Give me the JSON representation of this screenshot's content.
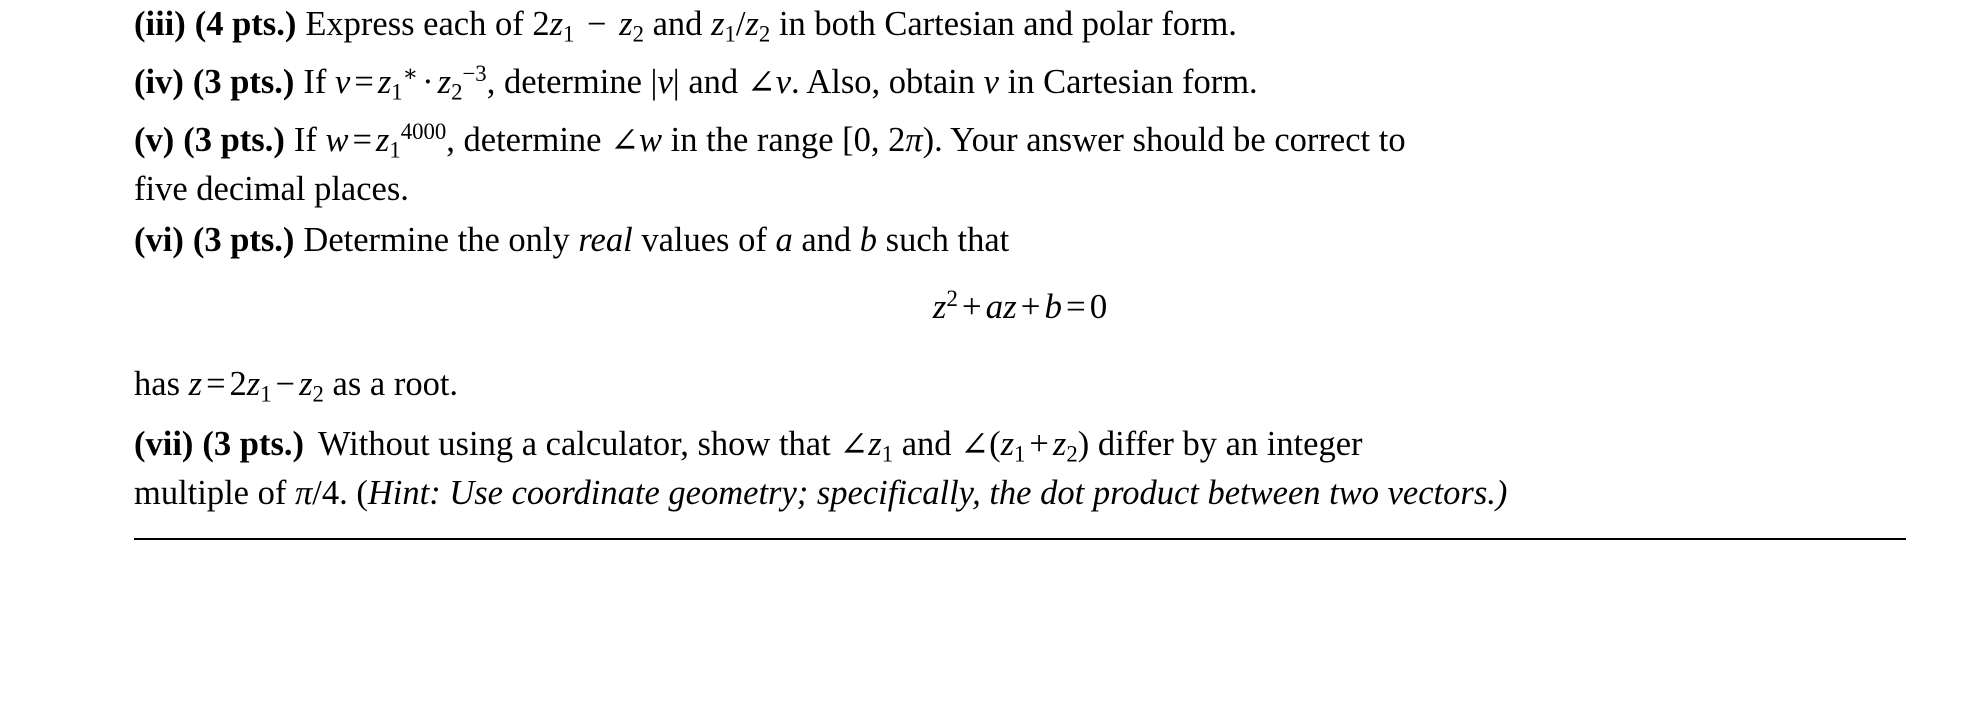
{
  "document": {
    "type": "math-problem-set",
    "font_color": "#000000",
    "background_color": "#ffffff"
  },
  "items": [
    {
      "id": "iii",
      "label": "(iii)",
      "points": "(4 pts.)",
      "text_parts": {
        "p1": "Express each of 2",
        "p2": "z",
        "sub1": "1",
        "p3": " − ",
        "p4": "z",
        "sub2": "2",
        "p5": " and ",
        "p6": "z",
        "sub3": "1",
        "p7": "/",
        "p8": "z",
        "sub4": "2",
        "p9": " in both Cartesian and polar form."
      },
      "plain": "(iii) (4 pts.) Express each of 2z₁ − z₂ and z₁/z₂ in both Cartesian and polar form."
    },
    {
      "id": "iv",
      "label": "(iv)",
      "points": "(3 pts.)",
      "plain": "(iv) (3 pts.) If v = z₁* · z₂⁻³, determine |v| and ∠v. Also, obtain v in Cartesian form.",
      "frag": {
        "if": "If ",
        "v": "v",
        "eq": "=",
        "z": "z",
        "one": "1",
        "star": "∗",
        "dot": "·",
        "z2": "z",
        "two": "2",
        "exp": "−3",
        "comma_determine": ", determine ",
        "absv_open": "|",
        "absv_close": "|",
        "and": " and ",
        "anglev": "v",
        "also": ". Also, obtain ",
        "vlast": "v",
        "tail": " in Cartesian form."
      }
    },
    {
      "id": "v",
      "label": "(v)",
      "points": "(3 pts.)",
      "plain": "(v) (3 pts.) If w = z₁^4000, determine ∠w in the range [0, 2π). Your answer should be correct to five decimal places.",
      "frag": {
        "if": "If ",
        "w": "w",
        "eq": "=",
        "z": "z",
        "one": "1",
        "power": "4000",
        "determine": ", determine ",
        "wang": "w",
        "range_text": " in the range [0, 2",
        "pi": "π",
        "range_close": "). Your answer should be correct to",
        "line2": "five decimal places."
      }
    },
    {
      "id": "vi",
      "label": "(vi)",
      "points": "(3 pts.)",
      "plain": "(vi) (3 pts.) Determine the only real values of a and b such that",
      "frag": {
        "t1": "Determine the only ",
        "real": "real",
        "t2": " values of ",
        "a": "a",
        "t3": " and ",
        "b": "b",
        "t4": " such that"
      }
    },
    {
      "id": "has-root",
      "plain": "has z = 2z₁ − z₂ as a root.",
      "frag": {
        "has": "has ",
        "z": "z",
        "eq": "=",
        "two": "2",
        "z1": "z",
        "sub1": "1",
        "minus": "−",
        "z2": "z",
        "sub2": "2",
        "tail": " as a root."
      }
    },
    {
      "id": "vii",
      "label": "(vii)",
      "points": "(3 pts.)",
      "plain": "(vii) (3 pts.) Without using a calculator, show that ∠z₁ and ∠(z₁ + z₂) differ by an integer multiple of π/4. (Hint: Use coordinate geometry; specifically, the dot product between two vectors.)",
      "frag": {
        "t1": "Without using a calculator, show that ",
        "z": "z",
        "sub1": "1",
        "t2": " and ",
        "open": "(",
        "z1b": "z",
        "sub1b": "1",
        "plus": "+",
        "z2b": "z",
        "sub2b": "2",
        "close": ")",
        "t3": " differ by an integer",
        "line2a": "multiple of ",
        "pi": "π",
        "slash4": "/4. (",
        "hint_label": "Hint:",
        "hint_text": " Use coordinate geometry; specifically, the dot product between two vectors.",
        "close_paren": ")"
      }
    }
  ],
  "equation": {
    "id": "quadratic",
    "plain": "z² + az + b = 0",
    "frag": {
      "z": "z",
      "sup2": "2",
      "plus1": "+",
      "a": "a",
      "z2": "z",
      "plus2": "+",
      "b": "b",
      "eq": "=",
      "zero": "0"
    }
  },
  "symbols": {
    "angle": "∠",
    "minus": "−",
    "middot": "·",
    "star": "∗",
    "equals": "=",
    "plus": "+",
    "pi": "π"
  },
  "footer_rule": {
    "present": true,
    "color": "#000000"
  }
}
